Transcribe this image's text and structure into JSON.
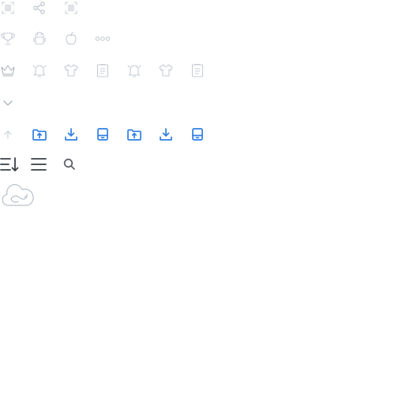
{
  "icon_sheet": {
    "row1": [
      "barcode-scan-icon",
      "share-icon",
      "barcode-scan-icon"
    ],
    "row2": [
      "trophy-icon",
      "android-icon",
      "apple-icon",
      "more-dots-icon"
    ],
    "row3": [
      "crown-icon",
      "bell-icon",
      "tshirt-icon",
      "clipboard-icon",
      "bell-icon",
      "tshirt-icon",
      "clipboard-icon"
    ],
    "row4": [
      "chevron-down-icon"
    ],
    "row5": [
      "arrow-up-icon",
      "folder-upload-icon",
      "download-icon",
      "drive-icon",
      "folder-upload-icon",
      "download-icon",
      "drive-icon"
    ],
    "row6": [
      "sort-list-icon",
      "menu-icon",
      "search-icon"
    ],
    "row7": [
      "cloud-sync-icon"
    ]
  },
  "colors": {
    "faint": "#c5ccd4",
    "blue": "#2f7fe3",
    "dark": "#3a3f47",
    "muted": "#6b7076"
  }
}
